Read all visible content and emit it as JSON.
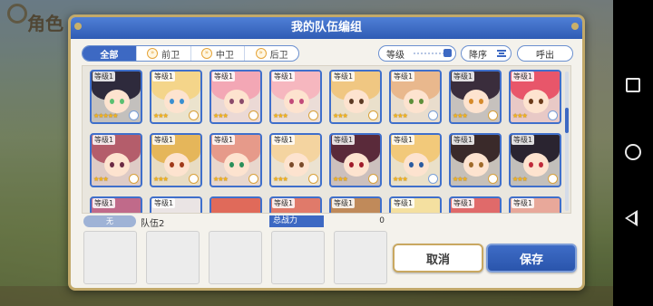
{
  "background": {
    "title": "角色",
    "bottom_items": [
      "",
      "",
      "",
      ""
    ]
  },
  "dialog": {
    "title": "我的队伍编组"
  },
  "filters": {
    "tabs": [
      {
        "label": "全部",
        "active": true,
        "icon": ""
      },
      {
        "label": "前卫",
        "active": false,
        "icon": "front-position-icon"
      },
      {
        "label": "中卫",
        "active": false,
        "icon": "middle-position-icon"
      },
      {
        "label": "后卫",
        "active": false,
        "icon": "rear-position-icon"
      }
    ],
    "sort_field": "等级",
    "sort_order": "降序",
    "call_label": "呼出"
  },
  "characters": [
    {
      "level": "等级1",
      "stars": "★★★★★",
      "hair": "#2e2a3c",
      "eye": "#5ac071",
      "badge": "blue"
    },
    {
      "level": "等级1",
      "stars": "★★★",
      "hair": "#f4d58a",
      "eye": "#3a8fd0",
      "badge": "gold"
    },
    {
      "level": "等级1",
      "stars": "★★★",
      "hair": "#f3a7b5",
      "eye": "#8a4a6a",
      "badge": "gold"
    },
    {
      "level": "等级1",
      "stars": "★★★",
      "hair": "#f6b7bf",
      "eye": "#c24a7a",
      "badge": "gold"
    },
    {
      "level": "等级1",
      "stars": "★★★",
      "hair": "#f0c782",
      "eye": "#5c3a24",
      "badge": "gold"
    },
    {
      "level": "等级1",
      "stars": "★★★",
      "hair": "#e9b88d",
      "eye": "#5d8f3a",
      "badge": "blue"
    },
    {
      "level": "等级1",
      "stars": "★★★",
      "hair": "#3a2d3c",
      "eye": "#d68a2a",
      "badge": "gold"
    },
    {
      "level": "等级1",
      "stars": "★★★",
      "hair": "#e8566a",
      "eye": "#6a3a1a",
      "badge": "blue"
    },
    {
      "level": "等级1",
      "stars": "★★★",
      "hair": "#b45d6b",
      "eye": "#6b2a44",
      "badge": "gold"
    },
    {
      "level": "等级1",
      "stars": "★★★",
      "hair": "#e5b65a",
      "eye": "#a03a1a",
      "badge": "gold"
    },
    {
      "level": "等级1",
      "stars": "★★★",
      "hair": "#e69a8a",
      "eye": "#2a8f5a",
      "badge": "gold"
    },
    {
      "level": "等级1",
      "stars": "★★★",
      "hair": "#f4d4a0",
      "eye": "#7a4a2a",
      "badge": "gold"
    },
    {
      "level": "等级1",
      "stars": "★★★",
      "hair": "#5a2a3a",
      "eye": "#a01a2a",
      "badge": "gold"
    },
    {
      "level": "等级1",
      "stars": "★★★",
      "hair": "#f2c97a",
      "eye": "#2a5aa0",
      "badge": "blue"
    },
    {
      "level": "等级1",
      "stars": "★★★",
      "hair": "#3a2a2a",
      "eye": "#a06a2a",
      "badge": "gold"
    },
    {
      "level": "等级1",
      "stars": "★★★",
      "hair": "#2a2430",
      "eye": "#c02a3a",
      "badge": "gold"
    },
    {
      "level": "等级1",
      "stars": "",
      "hair": "#c06a8a",
      "eye": "#6a3a5a",
      "badge": ""
    },
    {
      "level": "等级1",
      "stars": "",
      "hair": "#eae4e4",
      "eye": "#6a6a8a",
      "badge": ""
    },
    {
      "level": "",
      "stars": "",
      "hair": "#e06a5a",
      "eye": "#6a2a2a",
      "badge": ""
    },
    {
      "level": "等级1",
      "stars": "",
      "hair": "#e07a6a",
      "eye": "#6a3a2a",
      "badge": ""
    },
    {
      "level": "等级1",
      "stars": "",
      "hair": "#c08a5a",
      "eye": "#5a3a2a",
      "badge": ""
    },
    {
      "level": "等级1",
      "stars": "",
      "hair": "#f4e0a0",
      "eye": "#4a6a9a",
      "badge": ""
    },
    {
      "level": "等级1",
      "stars": "",
      "hair": "#e06a6a",
      "eye": "#6a2a2a",
      "badge": ""
    },
    {
      "level": "等级1",
      "stars": "",
      "hair": "#e8a89a",
      "eye": "#6a3a3a",
      "badge": ""
    }
  ],
  "team": {
    "none_label": "无",
    "name": "队伍2",
    "power_label": "总战力",
    "power_value": "0",
    "slot_count": 5
  },
  "actions": {
    "cancel_label": "取消",
    "save_label": "保存"
  },
  "colors": {
    "accent": "#3d69c3",
    "frame": "#c2a96a",
    "star": "#f2b31c"
  }
}
